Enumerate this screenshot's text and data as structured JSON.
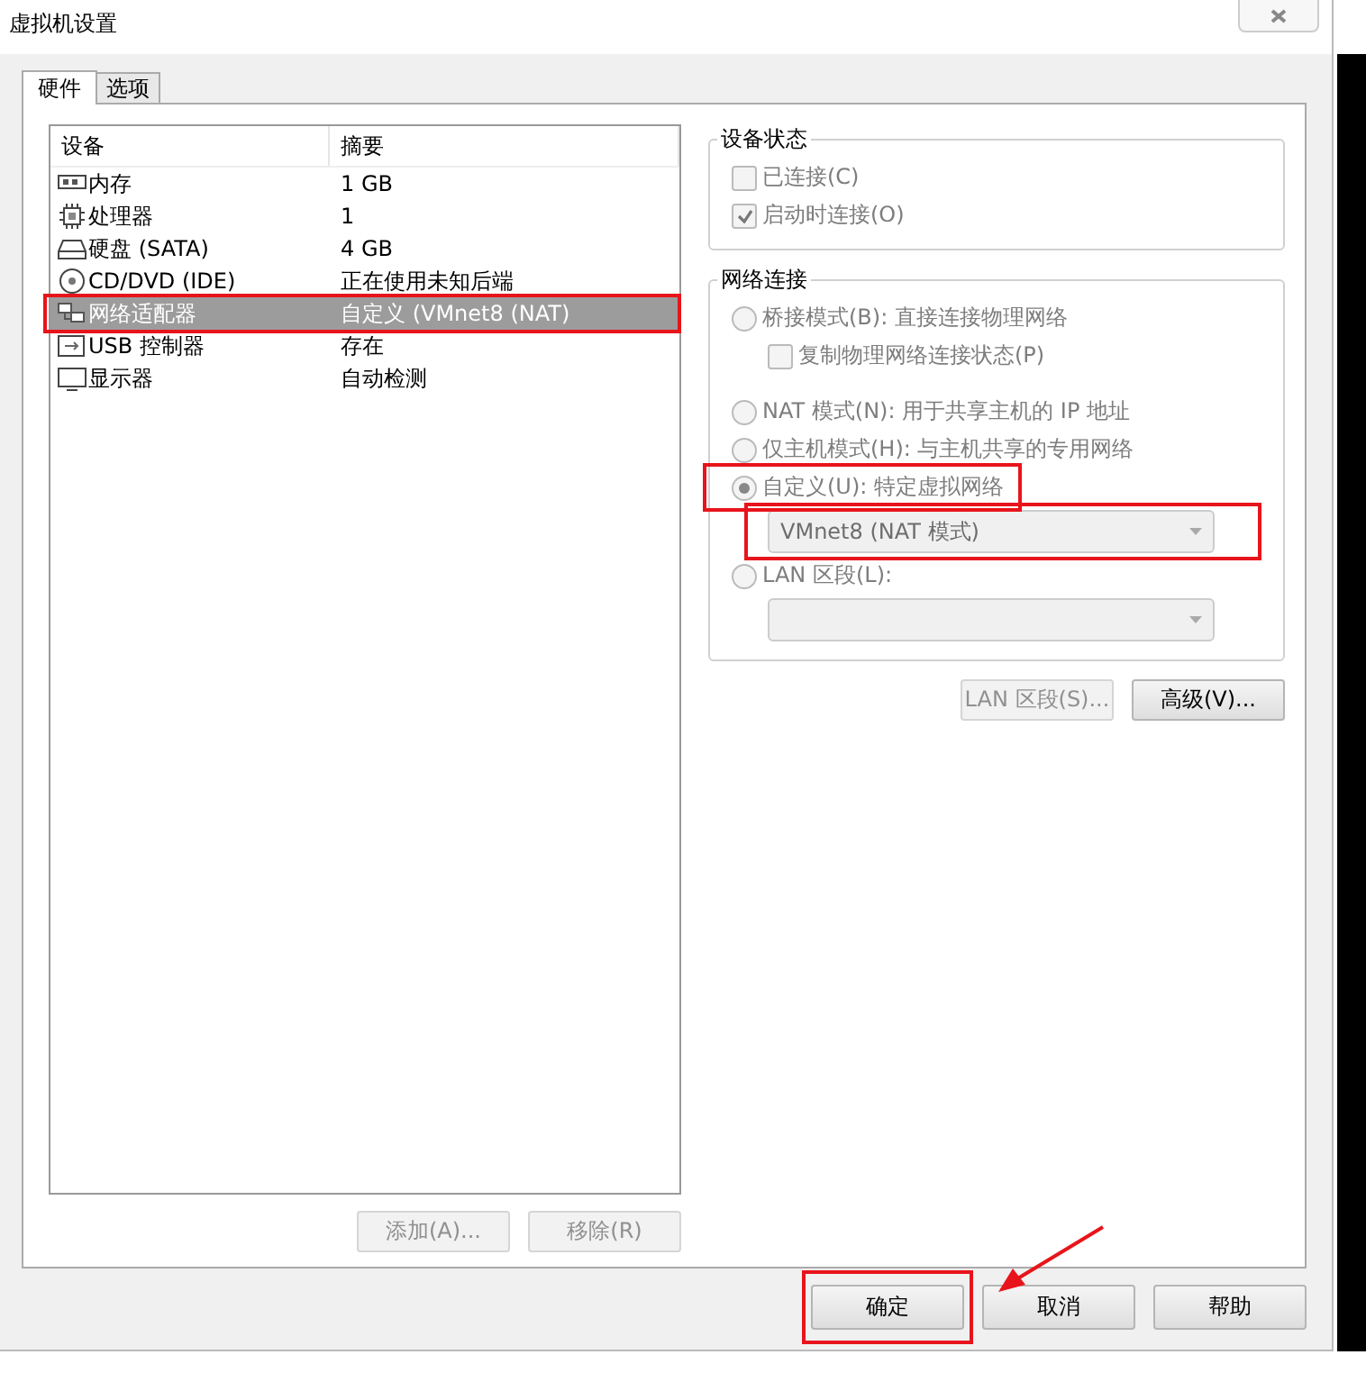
{
  "window": {
    "title": "虚拟机设置"
  },
  "tabs": [
    {
      "label": "硬件",
      "selected": true
    },
    {
      "label": "选项",
      "selected": false
    }
  ],
  "device_list": {
    "columns": [
      "设备",
      "摘要"
    ],
    "rows": [
      {
        "kind": "memory",
        "device": "内存",
        "summary": "1 GB",
        "selected": false
      },
      {
        "kind": "cpu",
        "device": "处理器",
        "summary": "1",
        "selected": false
      },
      {
        "kind": "disk",
        "device": "硬盘 (SATA)",
        "summary": "4 GB",
        "selected": false
      },
      {
        "kind": "cdrom",
        "device": "CD/DVD (IDE)",
        "summary": "正在使用未知后端",
        "selected": false
      },
      {
        "kind": "network",
        "device": "网络适配器",
        "summary": "自定义 (VMnet8 (NAT)",
        "selected": true
      },
      {
        "kind": "usb",
        "device": "USB 控制器",
        "summary": "存在",
        "selected": false
      },
      {
        "kind": "display",
        "device": "显示器",
        "summary": "自动检测",
        "selected": false
      }
    ]
  },
  "list_buttons": [
    {
      "label": "添加(A)...",
      "disabled": true
    },
    {
      "label": "移除(R)",
      "disabled": true
    }
  ],
  "device_status": {
    "title": "设备状态",
    "options": [
      {
        "kind": "checkbox",
        "label": "已连接(C)",
        "checked": false,
        "disabled": true
      },
      {
        "kind": "checkbox",
        "label": "启动时连接(O)",
        "checked": true,
        "disabled": true
      }
    ]
  },
  "network_connection": {
    "title": "网络连接",
    "options": [
      {
        "kind": "radio",
        "label": "桥接模式(B): 直接连接物理网络",
        "selected": false,
        "disabled": true,
        "children": [
          {
            "kind": "checkbox",
            "label": "复制物理网络连接状态(P)",
            "checked": false,
            "disabled": true
          }
        ]
      },
      {
        "kind": "radio",
        "label": "NAT 模式(N): 用于共享主机的 IP 地址",
        "selected": false,
        "disabled": true
      },
      {
        "kind": "radio",
        "label": "仅主机模式(H): 与主机共享的专用网络",
        "selected": false,
        "disabled": true
      },
      {
        "kind": "radio",
        "label": "自定义(U): 特定虚拟网络",
        "selected": true,
        "disabled": true,
        "dropdown": {
          "value": "VMnet8 (NAT 模式)",
          "disabled": true
        }
      },
      {
        "kind": "radio",
        "label": "LAN 区段(L):",
        "selected": false,
        "disabled": true,
        "dropdown": {
          "disabled": true
        }
      }
    ]
  },
  "network_buttons": [
    {
      "label": "LAN 区段(S)...",
      "disabled": true
    },
    {
      "label": "高级(V)...",
      "disabled": false
    }
  ],
  "footer_buttons": [
    {
      "label": "确定"
    },
    {
      "label": "取消"
    },
    {
      "label": "帮助"
    }
  ]
}
